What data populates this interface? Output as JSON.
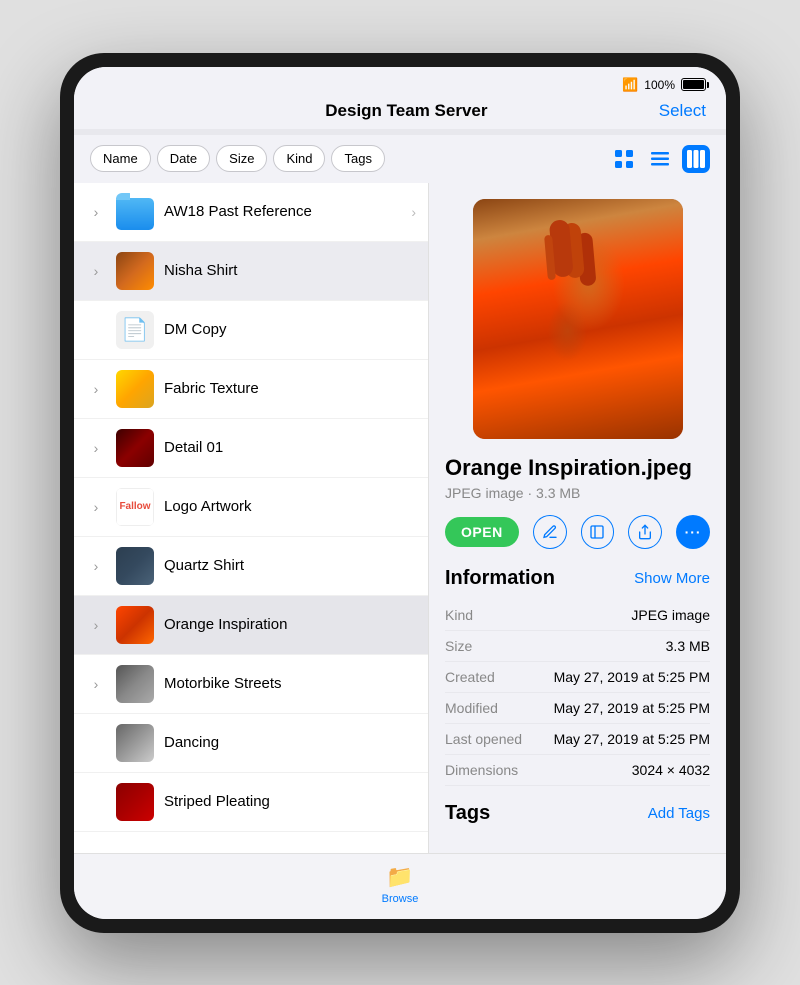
{
  "device": {
    "status_bar": {
      "wifi": "📶",
      "battery_percent": "100%"
    }
  },
  "nav": {
    "title": "Design Team Server",
    "select_label": "Select"
  },
  "sort": {
    "pills": [
      "Name",
      "Date",
      "Size",
      "Kind",
      "Tags"
    ]
  },
  "files": [
    {
      "id": 1,
      "name": "AW18 Past Reference",
      "thumb_type": "folder",
      "has_chevron_left": true,
      "has_chevron_right": true
    },
    {
      "id": 2,
      "name": "Nisha Shirt",
      "thumb_type": "nisha",
      "has_chevron_left": true,
      "has_chevron_right": false
    },
    {
      "id": 3,
      "name": "DM Copy",
      "thumb_type": "doc",
      "has_chevron_left": false,
      "has_chevron_right": false
    },
    {
      "id": 4,
      "name": "Fabric Texture",
      "thumb_type": "fabric",
      "has_chevron_left": true,
      "has_chevron_right": false
    },
    {
      "id": 5,
      "name": "Detail 01",
      "thumb_type": "detail01",
      "has_chevron_left": true,
      "has_chevron_right": false
    },
    {
      "id": 6,
      "name": "Logo Artwork",
      "thumb_type": "logo",
      "has_chevron_left": true,
      "has_chevron_right": false
    },
    {
      "id": 7,
      "name": "Quartz Shirt",
      "thumb_type": "quartz",
      "has_chevron_left": true,
      "has_chevron_right": false
    },
    {
      "id": 8,
      "name": "Orange Inspiration",
      "thumb_type": "orange",
      "has_chevron_left": true,
      "has_chevron_right": false,
      "selected": true
    },
    {
      "id": 9,
      "name": "Motorbike Streets",
      "thumb_type": "motorbike",
      "has_chevron_left": true,
      "has_chevron_right": false
    },
    {
      "id": 10,
      "name": "Dancing",
      "thumb_type": "dancing",
      "has_chevron_left": false,
      "has_chevron_right": false
    },
    {
      "id": 11,
      "name": "Striped Pleating",
      "thumb_type": "striped",
      "has_chevron_left": false,
      "has_chevron_right": false
    }
  ],
  "detail": {
    "filename": "Orange Inspiration.jpeg",
    "subtitle": "JPEG image · 3.3 MB",
    "open_button": "OPEN",
    "info_title": "Information",
    "show_more": "Show More",
    "info_rows": [
      {
        "label": "Kind",
        "value": "JPEG image"
      },
      {
        "label": "Size",
        "value": "3.3 MB"
      },
      {
        "label": "Created",
        "value": "May 27, 2019 at 5:25 PM"
      },
      {
        "label": "Modified",
        "value": "May 27, 2019 at 5:25 PM"
      },
      {
        "label": "Last opened",
        "value": "May 27, 2019 at 5:25 PM"
      },
      {
        "label": "Dimensions",
        "value": "3024 × 4032"
      }
    ],
    "tags_title": "Tags",
    "add_tags": "Add Tags"
  },
  "tab_bar": {
    "label": "Browse",
    "icon": "📁"
  }
}
